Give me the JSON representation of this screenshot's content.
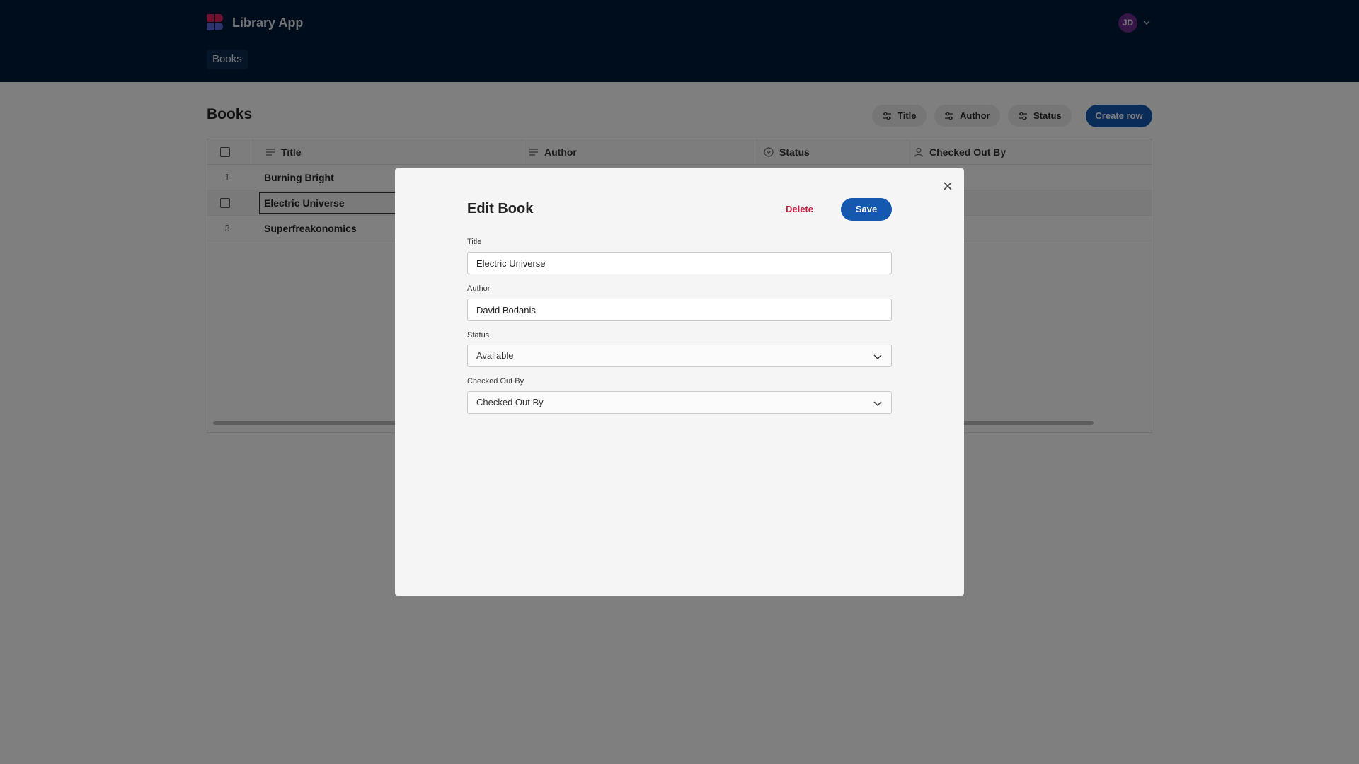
{
  "header": {
    "app_title": "Library App",
    "avatar_initials": "JD",
    "nav": [
      {
        "label": "Books"
      }
    ]
  },
  "page": {
    "title": "Books",
    "filters": [
      {
        "label": "Title"
      },
      {
        "label": "Author"
      },
      {
        "label": "Status"
      }
    ],
    "create_label": "Create row"
  },
  "table": {
    "columns": [
      {
        "label": "Title",
        "icon": "text-lines-icon"
      },
      {
        "label": "Author",
        "icon": "text-lines-icon"
      },
      {
        "label": "Status",
        "icon": "circle-check-icon"
      },
      {
        "label": "Checked Out By",
        "icon": "person-icon"
      }
    ],
    "rows": [
      {
        "num": "1",
        "title": "Burning Bright"
      },
      {
        "num": "",
        "title": "Electric Universe"
      },
      {
        "num": "3",
        "title": "Superfreakonomics"
      }
    ]
  },
  "modal": {
    "title": "Edit Book",
    "delete_label": "Delete",
    "save_label": "Save",
    "fields": {
      "title": {
        "label": "Title",
        "value": "Electric Universe"
      },
      "author": {
        "label": "Author",
        "value": "David Bodanis"
      },
      "status": {
        "label": "Status",
        "value": "Available"
      },
      "checked_out_by": {
        "label": "Checked Out By",
        "value": "Checked Out By"
      }
    }
  },
  "colors": {
    "header_bg": "#011a3a",
    "primary": "#1558b0",
    "danger": "#c4183c",
    "avatar": "#6a2c8e"
  }
}
